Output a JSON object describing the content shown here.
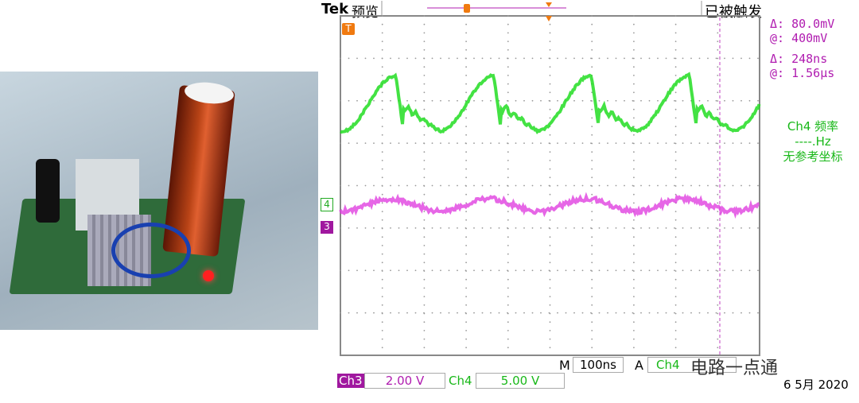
{
  "header": {
    "brand": "Tek",
    "mode": "预览",
    "trigger_status": "已被触发"
  },
  "cursors": {
    "delta_v": "80.0mV",
    "at_v": "400mV",
    "delta_t": "248ns",
    "at_t": "1.56µs",
    "delta_label": "Δ:",
    "at_label": "@:"
  },
  "measurement": {
    "title": "Ch4 频率",
    "value": "----.Hz",
    "note": "无参考坐标"
  },
  "markers": {
    "trigger": "T",
    "ch4": "4",
    "ch3": "3"
  },
  "footer": {
    "m_label": "M",
    "timebase": "100ns",
    "a_label": "A",
    "trigger_source": "Ch4",
    "ch3_label": "Ch3",
    "ch3_scale": "2.00 V",
    "ch4_label": "Ch4",
    "ch4_scale": "5.00 V",
    "date": "6 5月  2020"
  },
  "watermark": "电路一点通",
  "colors": {
    "ch3": "#d01cd0",
    "ch4": "#22dd22",
    "trigger": "#f07a10",
    "grid": "#999999"
  }
}
